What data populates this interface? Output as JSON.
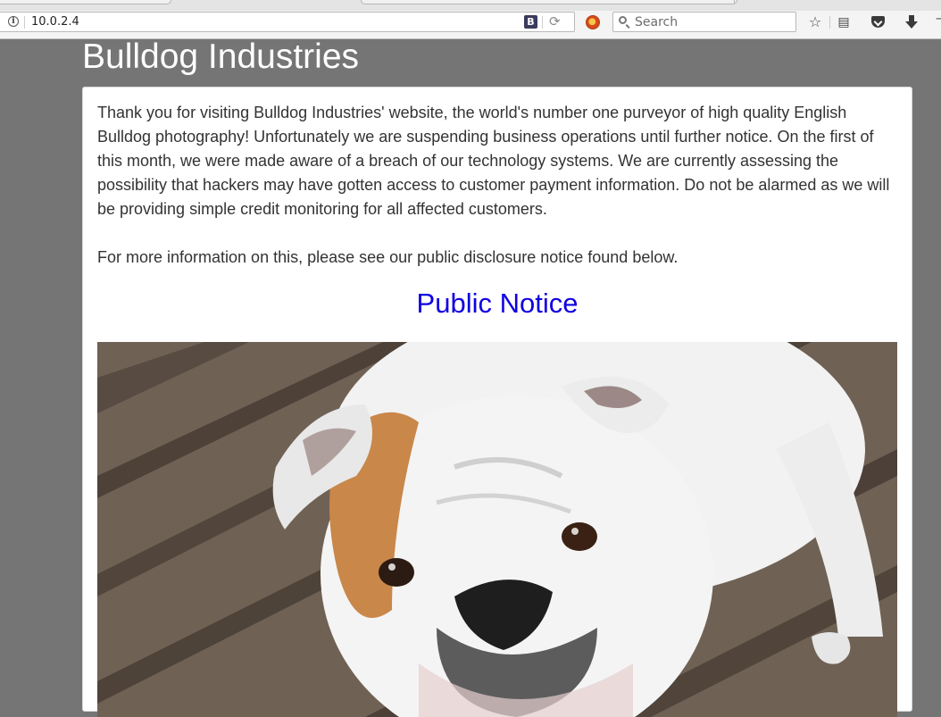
{
  "browser": {
    "url": "10.0.2.4",
    "search_placeholder": "Search",
    "icons": [
      "info-icon",
      "bold-b-icon",
      "reload-icon",
      "addon-icon",
      "search-icon",
      "bookmark-star-icon",
      "reader-icon",
      "pocket-icon",
      "download-icon"
    ]
  },
  "page": {
    "site_title": "Bulldog Industries",
    "intro": "Thank you for visiting Bulldog Industries' website, the world's number one purveyor of high quality English Bulldog photography! Unfortunately we are suspending business operations until further notice. On the first of this month, we were made aware of a breach of our technology systems. We are currently assessing the possibility that hackers may have gotten access to customer payment information. Do not be alarmed as we will be providing simple credit monitoring for all affected customers.",
    "more_info": "For more information on this, please see our public disclosure notice found below.",
    "notice_link": "Public Notice",
    "photo_subject": "english-bulldog-photo"
  },
  "colors": {
    "page_background": "#757575",
    "link": "#0f00e0",
    "title": "#ffffff",
    "body_text": "#333333"
  }
}
